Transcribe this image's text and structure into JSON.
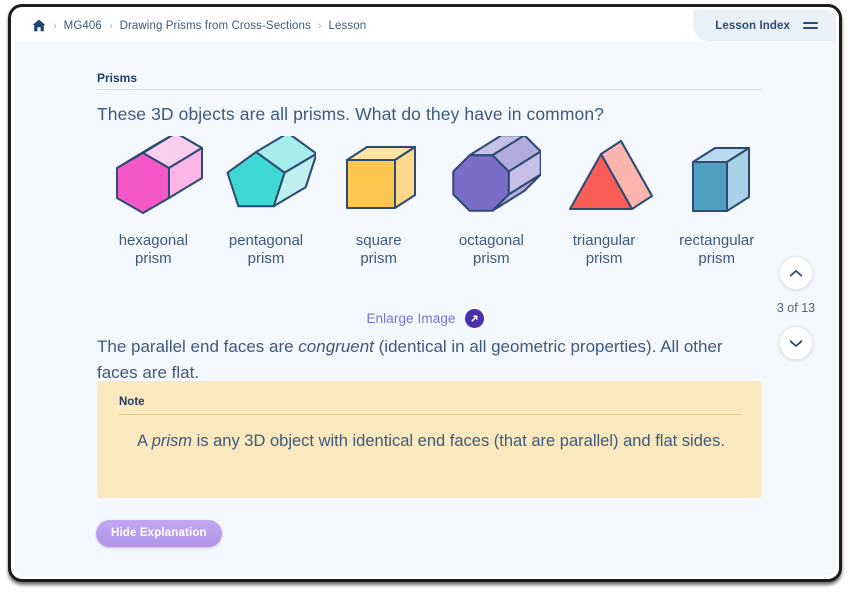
{
  "header": {
    "home_icon": "home-icon",
    "breadcrumb": [
      {
        "label": "MG406"
      },
      {
        "label": "Drawing Prisms from Cross-Sections"
      },
      {
        "label": "Lesson"
      }
    ],
    "separator": "›",
    "lesson_index_label": "Lesson Index",
    "menu_icon": "hamburger-icon"
  },
  "lesson": {
    "section_title": "Prisms",
    "question": "These 3D objects are all prisms. What do they have in common?",
    "enlarge_label": "Enlarge Image",
    "enlarge_icon": "expand-arrow-icon",
    "body_text_1": "The parallel end faces are ",
    "body_emphasis": "congruent",
    "body_text_2": " (identical in all geometric properties). All other faces are flat.",
    "note": {
      "title": "Note",
      "text_1": "A ",
      "emphasis": "prism",
      "text_2": " is any 3D object with identical end faces (that are parallel) and flat sides."
    },
    "hide_button_label": "Hide Explanation"
  },
  "prisms": [
    {
      "name": "hexagonal-prism",
      "label": "hexagonal\nprism",
      "shape": "hexagon",
      "front": "#f558c8",
      "top": "#fcb6e6",
      "side": "#fbcdee",
      "stroke": "#2c4a72"
    },
    {
      "name": "pentagonal-prism",
      "label": "pentagonal\nprism",
      "shape": "pentagon",
      "front": "#3fd9d3",
      "top": "#a6ecea",
      "side": "#bdf0ee",
      "stroke": "#2c4a72"
    },
    {
      "name": "square-prism",
      "label": "square\nprism",
      "shape": "square",
      "front": "#fdc košer",
      "front_color": "#fcc74e",
      "top": "#fde3a4",
      "side": "#fdd88a",
      "stroke": "#2c4a72"
    },
    {
      "name": "octagonal-prism",
      "label": "octagonal\nprism",
      "shape": "octagon",
      "front": "#7b6cc8",
      "top": "#c6bfe8",
      "side": "#b3aade",
      "stroke": "#2c4a72"
    },
    {
      "name": "triangular-prism",
      "label": "triangular\nprism",
      "shape": "triangle",
      "front": "#fa5d56",
      "top": "#fbb4ae",
      "side": "#fbc2bc",
      "stroke": "#2c4a72"
    },
    {
      "name": "rectangular-prism",
      "label": "rectangular\nprism",
      "shape": "rectangle",
      "front": "#4f9fc0",
      "top": "#b8dced",
      "side": "#a9d2e6",
      "stroke": "#2c4a72"
    }
  ],
  "pager": {
    "up_icon": "chevron-up-icon",
    "down_icon": "chevron-down-icon",
    "count_label": "3 of 13"
  },
  "colors": {
    "page_bg": "#f4f8fc",
    "header_bg": "#ffffff",
    "text": "#3d5a7d",
    "heading": "#1f3d66",
    "accent_purple": "#7b6fd0",
    "note_bg": "#fae9bf"
  }
}
